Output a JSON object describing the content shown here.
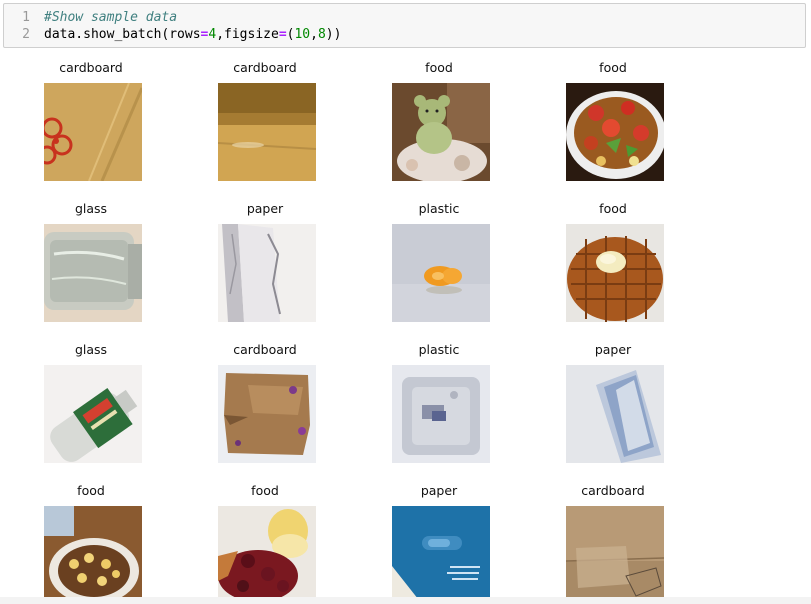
{
  "code": {
    "line1_number": "1",
    "line1_comment": "#Show sample data",
    "line2_number": "2",
    "line2_fn": "data.show_batch(rows",
    "line2_eq1": "=",
    "line2_rows": "4",
    "line2_mid": ",figsize",
    "line2_eq2": "=",
    "line2_open": "(",
    "line2_w": "10",
    "line2_comma": ",",
    "line2_h": "8",
    "line2_close": "))"
  },
  "batch": [
    {
      "label": "cardboard",
      "image": "cardboard-spiral-logo-photo"
    },
    {
      "label": "cardboard",
      "image": "cardboard-box-flap-photo"
    },
    {
      "label": "food",
      "image": "teddy-bear-plate-photo"
    },
    {
      "label": "food",
      "image": "salad-strawberries-photo"
    },
    {
      "label": "glass",
      "image": "glass-jar-photo"
    },
    {
      "label": "paper",
      "image": "crumpled-paper-photo"
    },
    {
      "label": "plastic",
      "image": "orange-bottle-cap-photo"
    },
    {
      "label": "food",
      "image": "waffle-butter-photo"
    },
    {
      "label": "glass",
      "image": "glass-bottle-green-label-photo"
    },
    {
      "label": "cardboard",
      "image": "torn-cardboard-photo"
    },
    {
      "label": "plastic",
      "image": "plastic-tray-photo"
    },
    {
      "label": "paper",
      "image": "folded-paper-photo"
    },
    {
      "label": "food",
      "image": "granola-plate-photo"
    },
    {
      "label": "food",
      "image": "cake-cherries-photo"
    },
    {
      "label": "paper",
      "image": "blue-paper-box-photo"
    },
    {
      "label": "cardboard",
      "image": "cardboard-tape-photo"
    }
  ]
}
